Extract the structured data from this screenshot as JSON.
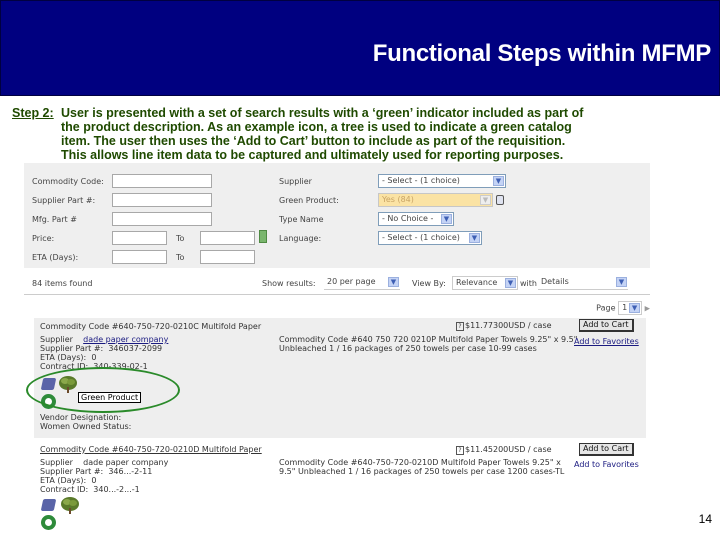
{
  "slide": {
    "title": "Functional Steps within MFMP",
    "step_label": "Step 2:",
    "step_lines": [
      "User is presented with a set of search results with a ‘green’ indicator included as part of",
      "the product description.  As an example icon, a tree is used to indicate a green catalog",
      "item.  The user then uses the ‘Add to Cart’ button to include as part of the requisition.",
      "This allows line item data to be captured and ultimately used for reporting purposes."
    ],
    "page_number": "14",
    "colors": {
      "banner": "#000080",
      "step_text": "#1f4a00",
      "highlight_oval": "#2a8a2a"
    }
  },
  "search": {
    "fields_left": [
      {
        "label": "Commodity Code:",
        "value": ""
      },
      {
        "label": "Supplier Part #:",
        "value": ""
      },
      {
        "label": "Mfg. Part #",
        "value": ""
      },
      {
        "label": "Price:",
        "to_label": "To",
        "value": "",
        "to_value": ""
      },
      {
        "label": "ETA (Days):",
        "to_label": "To",
        "value": "",
        "to_value": ""
      }
    ],
    "fields_right": [
      {
        "label": "Supplier",
        "selected": "- Select - (1 choice)"
      },
      {
        "label": "Green Product:",
        "selected": "Yes (84)"
      },
      {
        "label": "Type Name",
        "selected": "- No Choice -"
      },
      {
        "label": "Language:",
        "selected": "- Select - (1 choice)"
      }
    ]
  },
  "results_bar": {
    "items_found": "84 items found",
    "show_results_label": "Show results:",
    "show_results_value": "20 per page",
    "view_by_label": "View By:",
    "view_by_value": "Relevance",
    "with_label": "with",
    "with_value": "Details",
    "page_label": "Page",
    "page_value": "1"
  },
  "results": [
    {
      "title": "Commodity Code #640-750-720-0210C Multifold Paper",
      "supplier_label": "Supplier",
      "supplier": "dade paper company",
      "supplier_part_label": "Supplier Part #:",
      "supplier_part": "346037-2099",
      "eta_label": "ETA (Days):",
      "eta": "0",
      "contract_label": "Contract ID:",
      "contract": "340-339-02-1",
      "description": "Commodity Code #640 750 720 0210P Multifold Paper Towels 9.25\" x 9.5\" Unbleached 1 / 16 packages of 250 towels per case 10-99 cases",
      "price": "$11.77300USD / case",
      "add_to_cart": "Add to Cart",
      "add_to_favorites": "Add to Favorites",
      "tooltip": "Green Product",
      "vendor_designation_label": "Vendor Designation:",
      "women_owned_label": "Women Owned Status:"
    },
    {
      "title": "Commodity Code #640-750-720-0210D Multifold Paper",
      "supplier_label": "Supplier",
      "supplier": "dade paper company",
      "supplier_part_label": "Supplier Part #:",
      "supplier_part": "346...-2-11",
      "eta_label": "ETA (Days):",
      "eta": "0",
      "contract_label": "Contract ID:",
      "contract": "340...-2...-1",
      "description": "Commodity Code #640-750-720-0210D Multifold Paper Towels 9.25\" x 9.5\" Unbleached 1 / 16 packages of 250 towels per case 1200 cases-TL",
      "price": "$11.45200USD / case",
      "add_to_cart": "Add to Cart",
      "add_to_favorites": "Add to Favorites"
    }
  ]
}
